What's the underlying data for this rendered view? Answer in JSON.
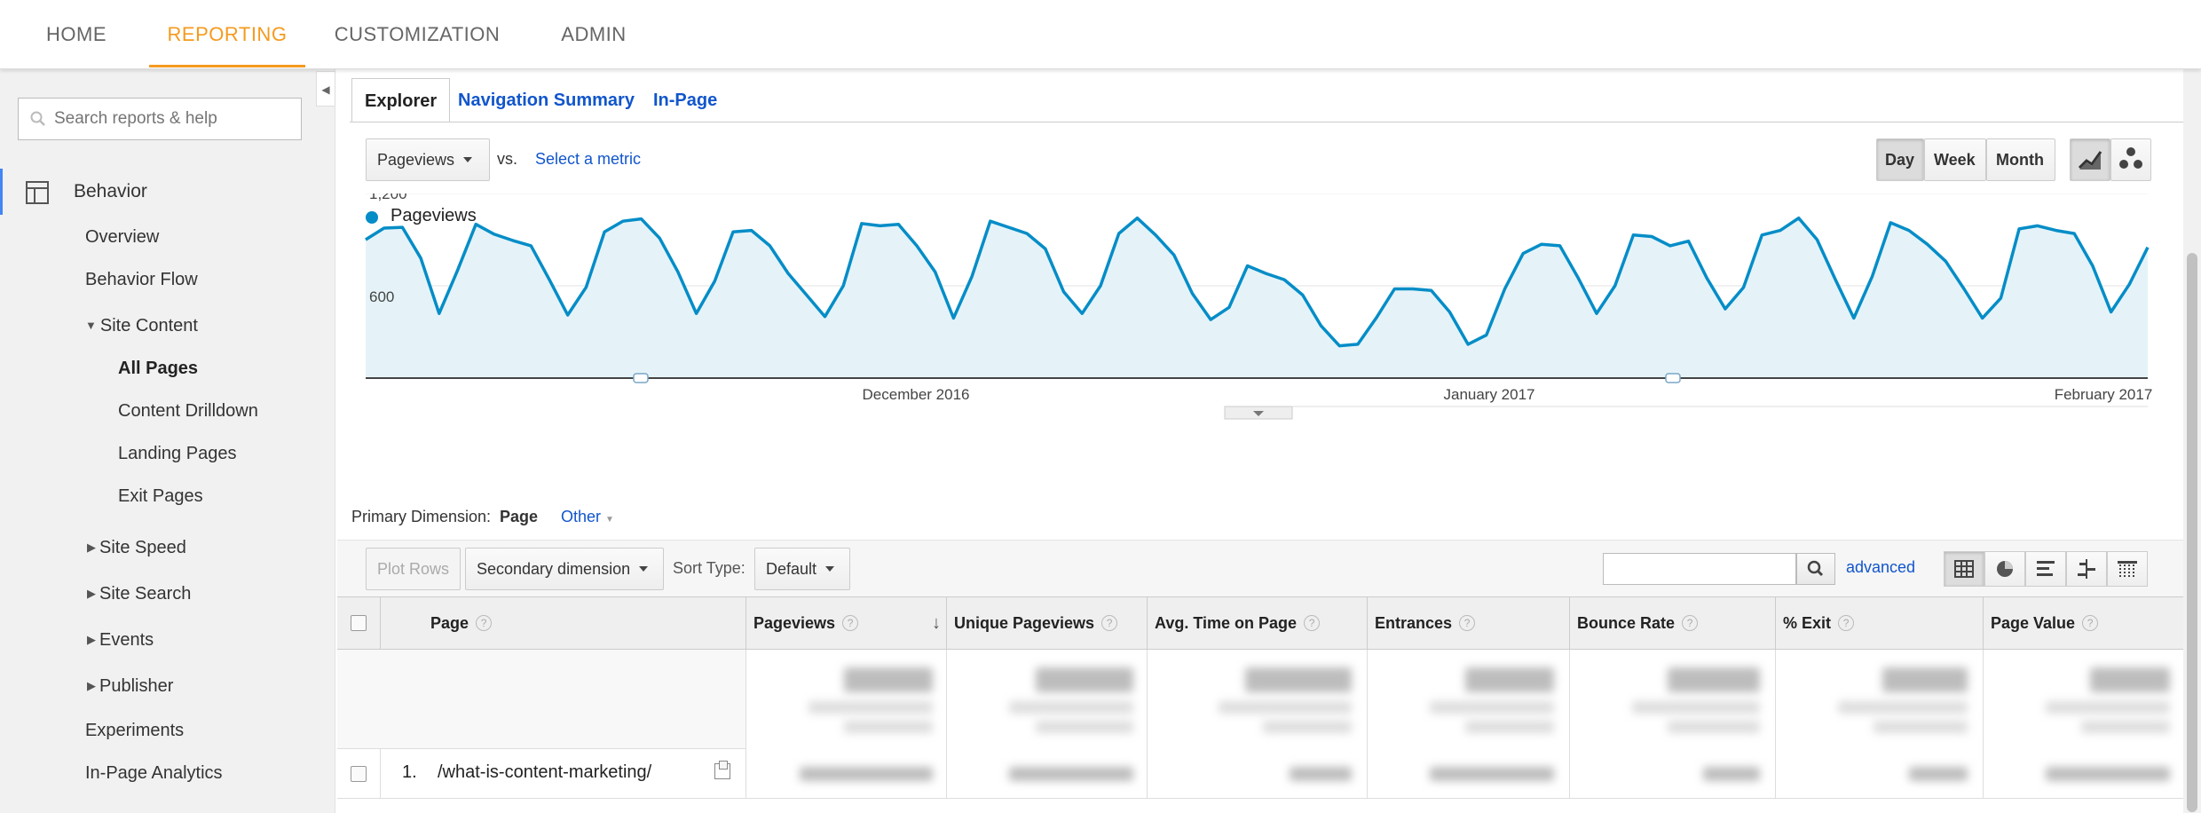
{
  "topnav": {
    "items": [
      {
        "label": "HOME",
        "active": false
      },
      {
        "label": "REPORTING",
        "active": true
      },
      {
        "label": "CUSTOMIZATION",
        "active": false
      },
      {
        "label": "ADMIN",
        "active": false
      }
    ],
    "accent_color": "#f59a1e"
  },
  "sidebar": {
    "search_placeholder": "Search reports & help",
    "section": "Behavior",
    "items": {
      "overview": "Overview",
      "behavior_flow": "Behavior Flow",
      "site_content": "Site Content",
      "all_pages": "All Pages",
      "content_drilldown": "Content Drilldown",
      "landing_pages": "Landing Pages",
      "exit_pages": "Exit Pages",
      "site_speed": "Site Speed",
      "site_search": "Site Search",
      "events": "Events",
      "publisher": "Publisher",
      "experiments": "Experiments",
      "in_page_analytics": "In-Page Analytics"
    }
  },
  "tabs": [
    "Explorer",
    "Navigation Summary",
    "In-Page"
  ],
  "controls": {
    "metric": "Pageviews",
    "vs": "vs.",
    "select_metric": "Select a metric",
    "granularity": [
      "Day",
      "Week",
      "Month"
    ],
    "active_granularity": "Day"
  },
  "chart_data": {
    "type": "area",
    "legend": "Pageviews",
    "series_color": "#058dc7",
    "fill_color": "#e5f3f9",
    "yticks": [
      "1,200",
      "600"
    ],
    "ylim": [
      0,
      1200
    ],
    "xlabels": [
      "December 2016",
      "January 2017",
      "February 2017"
    ],
    "values": [
      900,
      975,
      980,
      780,
      420,
      700,
      1000,
      935,
      895,
      860,
      640,
      410,
      590,
      950,
      1020,
      1035,
      910,
      690,
      420,
      630,
      950,
      960,
      860,
      680,
      540,
      400,
      600,
      1005,
      990,
      1000,
      860,
      690,
      390,
      660,
      1020,
      980,
      940,
      840,
      560,
      420,
      600,
      940,
      1040,
      930,
      800,
      550,
      380,
      460,
      730,
      680,
      640,
      540,
      340,
      210,
      220,
      390,
      580,
      580,
      570,
      430,
      220,
      280,
      580,
      810,
      870,
      860,
      650,
      420,
      600,
      930,
      920,
      860,
      890,
      650,
      450,
      590,
      930,
      960,
      1040,
      900,
      640,
      390,
      660,
      1010,
      960,
      870,
      760,
      580,
      390,
      520,
      970,
      990,
      960,
      940,
      730,
      430,
      610,
      850
    ]
  },
  "primary_dimension": {
    "label": "Primary Dimension:",
    "value": "Page",
    "other": "Other"
  },
  "table_toolbar": {
    "plot_rows": "Plot Rows",
    "secondary_dimension": "Secondary dimension",
    "sort_type_label": "Sort Type:",
    "sort_type_value": "Default",
    "advanced": "advanced"
  },
  "table": {
    "columns": [
      "Page",
      "Pageviews",
      "Unique Pageviews",
      "Avg. Time on Page",
      "Entrances",
      "Bounce Rate",
      "% Exit",
      "Page Value"
    ],
    "rows": [
      {
        "index": "1.",
        "page": "/what-is-content-marketing/"
      }
    ]
  }
}
